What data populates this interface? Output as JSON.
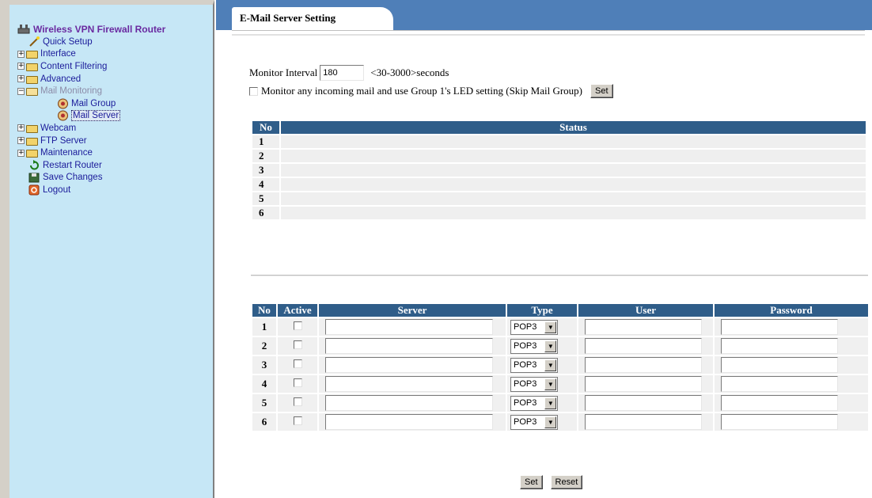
{
  "sidebar": {
    "root_title": "Wireless VPN Firewall Router",
    "items": [
      {
        "label": "Quick Setup"
      },
      {
        "label": "Interface"
      },
      {
        "label": "Content Filtering"
      },
      {
        "label": "Advanced"
      },
      {
        "label": "Mail Monitoring"
      },
      {
        "label": "Mail Group"
      },
      {
        "label": "Mail Server"
      },
      {
        "label": "Webcam"
      },
      {
        "label": "FTP Server"
      },
      {
        "label": "Maintenance"
      },
      {
        "label": "Restart Router"
      },
      {
        "label": "Save Changes"
      },
      {
        "label": "Logout"
      }
    ]
  },
  "tab": {
    "label": "E-Mail Server Setting"
  },
  "monitor": {
    "label": "Monitor Interval",
    "value": "180",
    "range_hint": "<30-3000>seconds",
    "led_text": "Monitor any incoming mail and use Group 1's LED setting (Skip Mail Group)",
    "set_label": "Set"
  },
  "status_table": {
    "headers": {
      "no": "No",
      "status": "Status"
    },
    "rows": [
      "1",
      "2",
      "3",
      "4",
      "5",
      "6"
    ]
  },
  "server_table": {
    "headers": {
      "no": "No",
      "active": "Active",
      "server": "Server",
      "type": "Type",
      "user": "User",
      "password": "Password"
    },
    "rows": [
      {
        "no": "1",
        "type": "POP3"
      },
      {
        "no": "2",
        "type": "POP3"
      },
      {
        "no": "3",
        "type": "POP3"
      },
      {
        "no": "4",
        "type": "POP3"
      },
      {
        "no": "5",
        "type": "POP3"
      },
      {
        "no": "6",
        "type": "POP3"
      }
    ]
  },
  "buttons": {
    "set": "Set",
    "reset": "Reset"
  },
  "colors": {
    "sidebar_bg": "#c6e7f6",
    "tab_bar": "#4f7fb8",
    "table_header": "#2f5d89"
  }
}
